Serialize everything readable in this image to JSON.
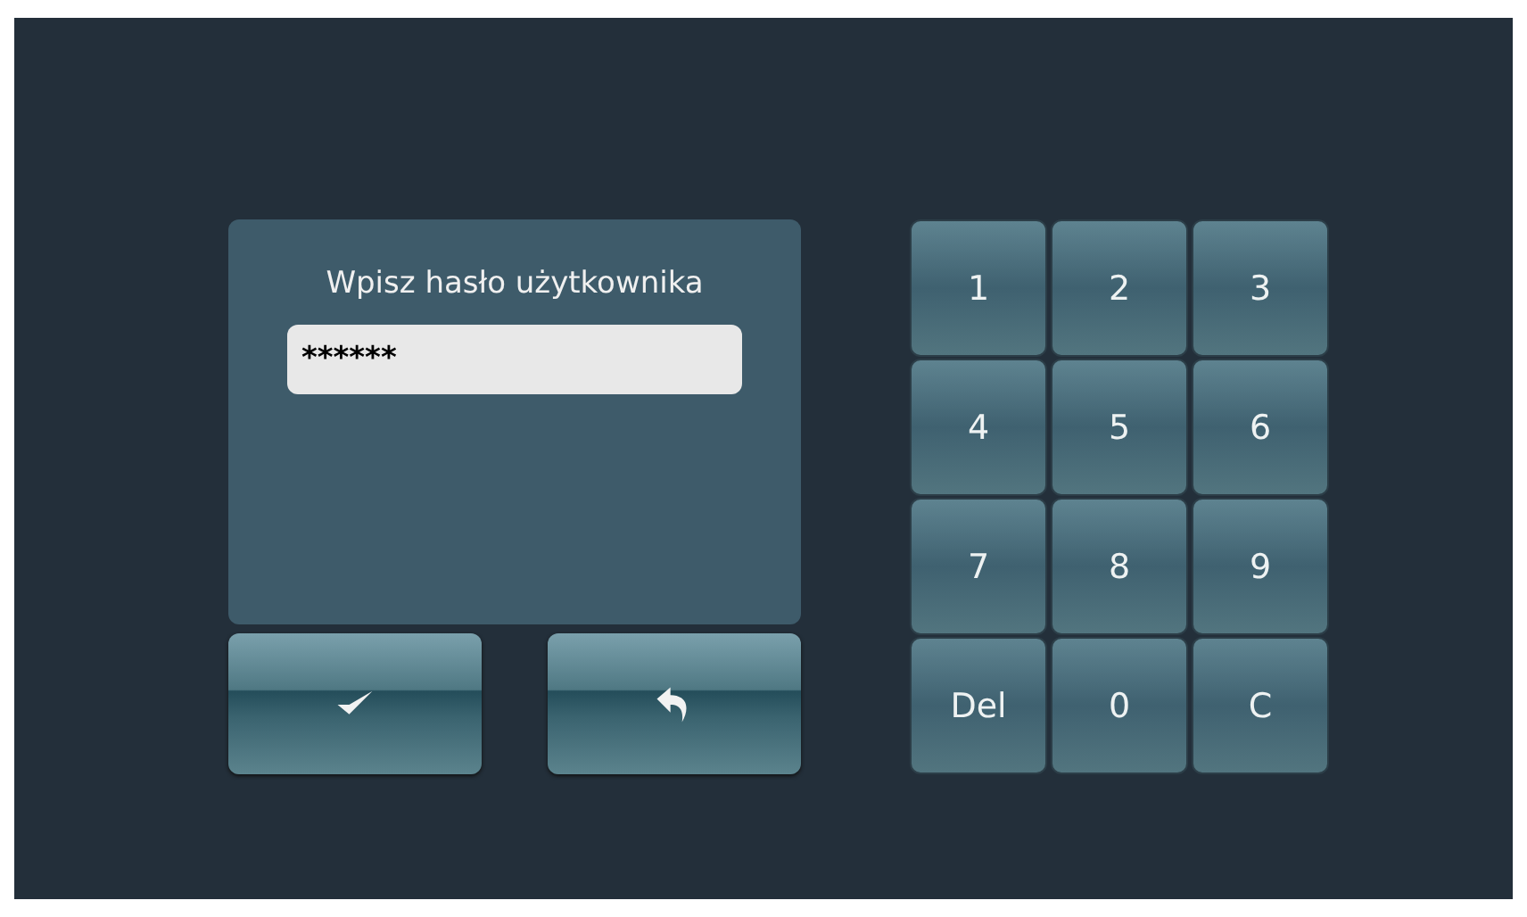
{
  "login": {
    "title": "Wpisz hasło użytkownika",
    "password": "******"
  },
  "actions": [
    {
      "kind": "confirm"
    },
    {
      "kind": "back"
    }
  ],
  "keypad": [
    "1",
    "2",
    "3",
    "4",
    "5",
    "6",
    "7",
    "8",
    "9",
    "Del",
    "0",
    "C"
  ]
}
